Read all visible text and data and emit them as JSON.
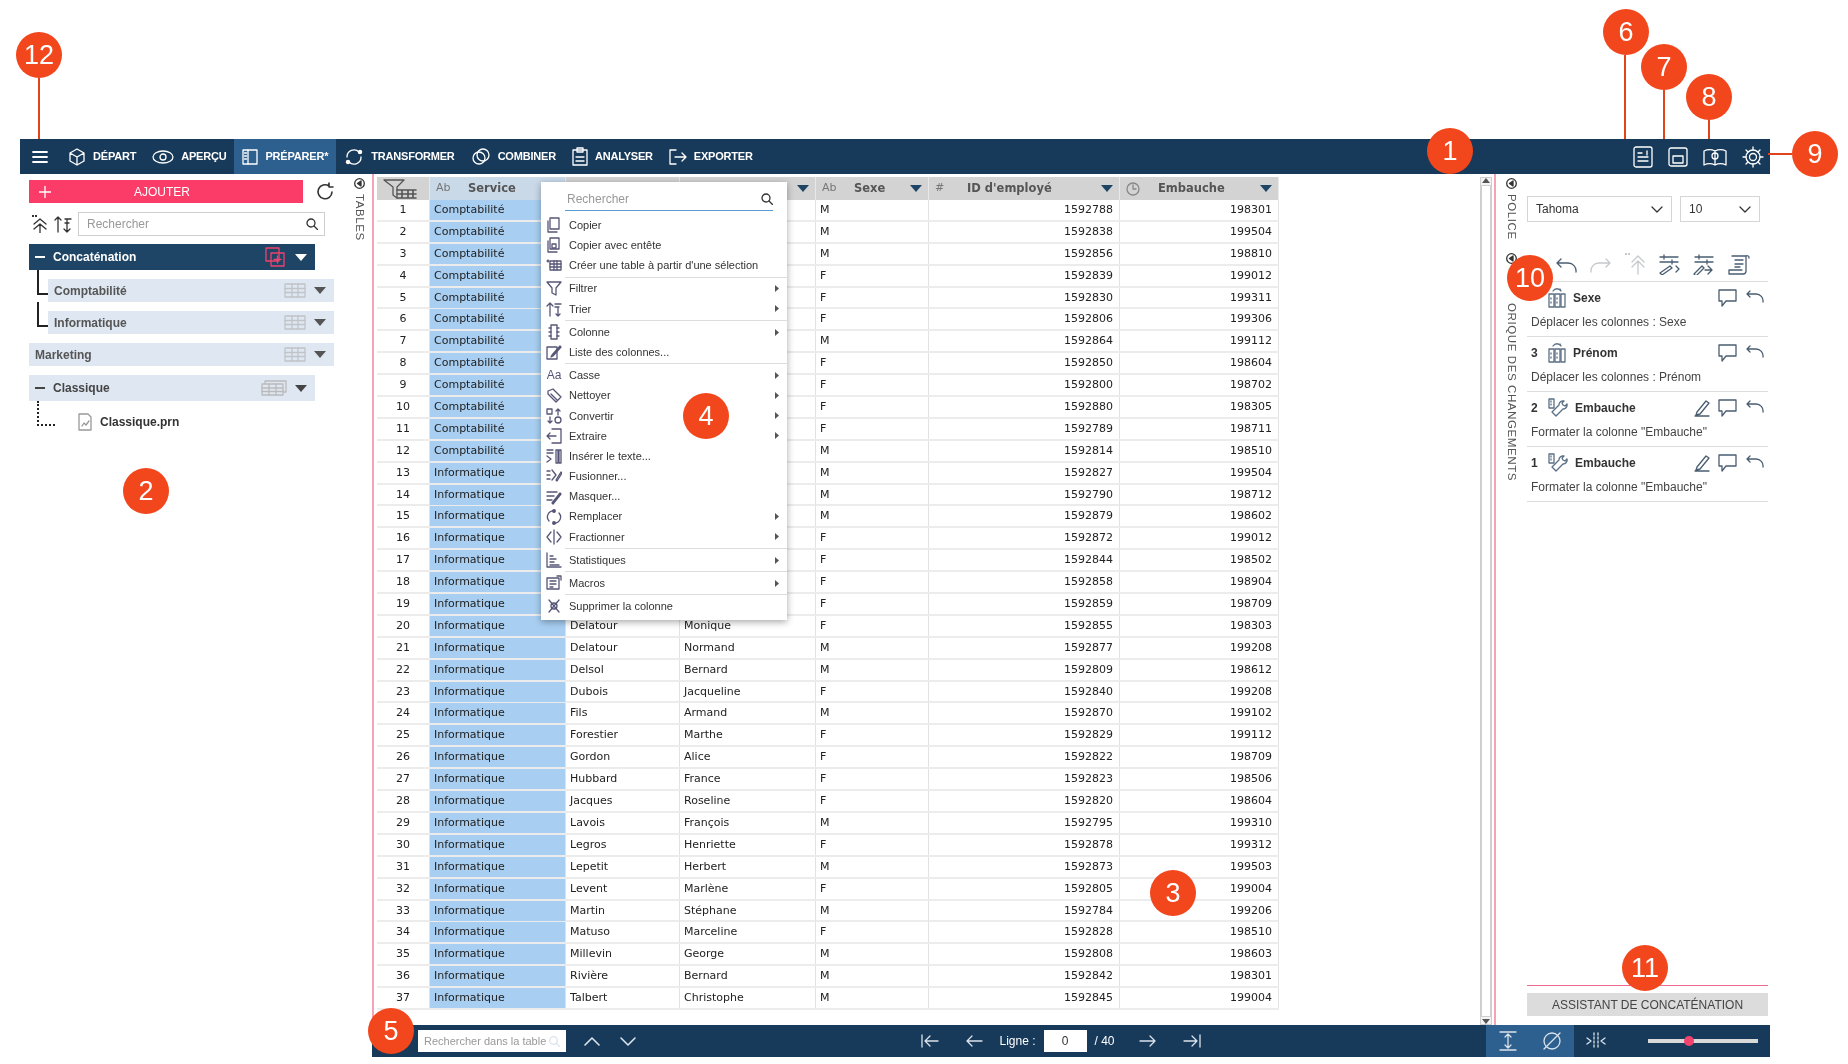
{
  "callouts": [
    {
      "number": "12"
    },
    {
      "number": "6"
    },
    {
      "number": "7"
    },
    {
      "number": "8"
    },
    {
      "number": "1"
    },
    {
      "number": "9"
    },
    {
      "number": "10"
    },
    {
      "number": "2"
    },
    {
      "number": "4"
    },
    {
      "number": "3"
    },
    {
      "number": "11"
    },
    {
      "number": "5"
    }
  ],
  "toolbar": {
    "nav": [
      {
        "label": "DÉPART",
        "selected": false
      },
      {
        "label": "APERÇU",
        "selected": false
      },
      {
        "label": "PRÉPARER*",
        "selected": true
      },
      {
        "label": "TRANSFORMER",
        "selected": false
      },
      {
        "label": "COMBINER",
        "selected": false
      },
      {
        "label": "ANALYSER",
        "selected": false
      },
      {
        "label": "EXPORTER",
        "selected": false
      }
    ]
  },
  "left_panel": {
    "add_button": "AJOUTER",
    "search": {
      "placeholder": "Rechercher"
    },
    "side_label": "TABLES",
    "tree": [
      {
        "label": "Concaténation",
        "kind": "group",
        "selected": true,
        "expanded": true,
        "children": [
          {
            "label": "Comptabilité",
            "kind": "table"
          },
          {
            "label": "Informatique",
            "kind": "table"
          }
        ]
      },
      {
        "label": "Marketing",
        "kind": "table"
      },
      {
        "label": "Classique",
        "kind": "group",
        "selected": false,
        "expanded": true,
        "children": [
          {
            "label": "Classique.prn",
            "kind": "file"
          }
        ]
      }
    ]
  },
  "table": {
    "columns": [
      {
        "kind": "text",
        "glyph": "Ab",
        "label": "Service",
        "selected": true
      },
      {
        "kind": "covered",
        "selected": false
      },
      {
        "kind": "covered",
        "selected": false,
        "caret": true
      },
      {
        "kind": "text",
        "glyph": "Ab",
        "label": "Sexe",
        "selected": false,
        "caret": true
      },
      {
        "kind": "number",
        "glyph": "#",
        "label": "ID d'employé",
        "selected": false,
        "caret": true
      },
      {
        "kind": "date",
        "label": "Embauche",
        "selected": false,
        "caret": true
      }
    ],
    "rows": [
      {
        "n": "1",
        "service": "Comptabilité",
        "sexe": "M",
        "id": "1592788",
        "embauche": "198301"
      },
      {
        "n": "2",
        "service": "Comptabilité",
        "sexe": "M",
        "id": "1592838",
        "embauche": "199504"
      },
      {
        "n": "3",
        "service": "Comptabilité",
        "sexe": "M",
        "id": "1592856",
        "embauche": "198810"
      },
      {
        "n": "4",
        "service": "Comptabilité",
        "sexe": "F",
        "id": "1592839",
        "embauche": "199012"
      },
      {
        "n": "5",
        "service": "Comptabilité",
        "sexe": "F",
        "id": "1592830",
        "embauche": "199311"
      },
      {
        "n": "6",
        "service": "Comptabilité",
        "sexe": "F",
        "id": "1592806",
        "embauche": "199306"
      },
      {
        "n": "7",
        "service": "Comptabilité",
        "sexe": "M",
        "id": "1592864",
        "embauche": "199112"
      },
      {
        "n": "8",
        "service": "Comptabilité",
        "sexe": "F",
        "id": "1592850",
        "embauche": "198604"
      },
      {
        "n": "9",
        "service": "Comptabilité",
        "sexe": "F",
        "id": "1592800",
        "embauche": "198702"
      },
      {
        "n": "10",
        "service": "Comptabilité",
        "sexe": "F",
        "id": "1592880",
        "embauche": "198305"
      },
      {
        "n": "11",
        "service": "Comptabilité",
        "sexe": "F",
        "id": "1592789",
        "embauche": "198711"
      },
      {
        "n": "12",
        "service": "Comptabilité",
        "sexe": "M",
        "id": "1592814",
        "embauche": "198510"
      },
      {
        "n": "13",
        "service": "Informatique",
        "sexe": "M",
        "id": "1592827",
        "embauche": "199504"
      },
      {
        "n": "14",
        "service": "Informatique",
        "sexe": "M",
        "id": "1592790",
        "embauche": "198712"
      },
      {
        "n": "15",
        "service": "Informatique",
        "sexe": "M",
        "id": "1592879",
        "embauche": "198602"
      },
      {
        "n": "16",
        "service": "Informatique",
        "sexe": "F",
        "id": "1592872",
        "embauche": "199012"
      },
      {
        "n": "17",
        "service": "Informatique",
        "sexe": "F",
        "id": "1592844",
        "embauche": "198502"
      },
      {
        "n": "18",
        "service": "Informatique",
        "sexe": "F",
        "id": "1592858",
        "embauche": "198904"
      },
      {
        "n": "19",
        "service": "Informatique",
        "sexe": "F",
        "id": "1592859",
        "embauche": "198709"
      },
      {
        "n": "20",
        "service": "Informatique",
        "nom": "Delatour",
        "prenom": "Monique",
        "sexe": "F",
        "id": "1592855",
        "embauche": "198303"
      },
      {
        "n": "21",
        "service": "Informatique",
        "nom": "Delatour",
        "prenom": "Normand",
        "sexe": "M",
        "id": "1592877",
        "embauche": "199208"
      },
      {
        "n": "22",
        "service": "Informatique",
        "nom": "Delsol",
        "prenom": "Bernard",
        "sexe": "M",
        "id": "1592809",
        "embauche": "198612"
      },
      {
        "n": "23",
        "service": "Informatique",
        "nom": "Dubois",
        "prenom": "Jacqueline",
        "sexe": "F",
        "id": "1592840",
        "embauche": "199208"
      },
      {
        "n": "24",
        "service": "Informatique",
        "nom": "Fils",
        "prenom": "Armand",
        "sexe": "M",
        "id": "1592870",
        "embauche": "199102"
      },
      {
        "n": "25",
        "service": "Informatique",
        "nom": "Forestier",
        "prenom": "Marthe",
        "sexe": "F",
        "id": "1592829",
        "embauche": "199112"
      },
      {
        "n": "26",
        "service": "Informatique",
        "nom": "Gordon",
        "prenom": "Alice",
        "sexe": "F",
        "id": "1592822",
        "embauche": "198709"
      },
      {
        "n": "27",
        "service": "Informatique",
        "nom": "Hubbard",
        "prenom": "France",
        "sexe": "F",
        "id": "1592823",
        "embauche": "198506"
      },
      {
        "n": "28",
        "service": "Informatique",
        "nom": "Jacques",
        "prenom": "Roseline",
        "sexe": "F",
        "id": "1592820",
        "embauche": "198604"
      },
      {
        "n": "29",
        "service": "Informatique",
        "nom": "Lavois",
        "prenom": "François",
        "sexe": "M",
        "id": "1592795",
        "embauche": "199310"
      },
      {
        "n": "30",
        "service": "Informatique",
        "nom": "Legros",
        "prenom": "Henriette",
        "sexe": "F",
        "id": "1592878",
        "embauche": "199312"
      },
      {
        "n": "31",
        "service": "Informatique",
        "nom": "Lepetit",
        "prenom": "Herbert",
        "sexe": "M",
        "id": "1592873",
        "embauche": "199503"
      },
      {
        "n": "32",
        "service": "Informatique",
        "nom": "Levent",
        "prenom": "Marlène",
        "sexe": "F",
        "id": "1592805",
        "embauche": "199004"
      },
      {
        "n": "33",
        "service": "Informatique",
        "nom": "Martin",
        "prenom": "Stéphane",
        "sexe": "M",
        "id": "1592784",
        "embauche": "199206"
      },
      {
        "n": "34",
        "service": "Informatique",
        "nom": "Matuso",
        "prenom": "Marceline",
        "sexe": "F",
        "id": "1592828",
        "embauche": "198510"
      },
      {
        "n": "35",
        "service": "Informatique",
        "nom": "Millevin",
        "prenom": "George",
        "sexe": "M",
        "id": "1592808",
        "embauche": "198603"
      },
      {
        "n": "36",
        "service": "Informatique",
        "nom": "Rivière",
        "prenom": "Bernard",
        "sexe": "M",
        "id": "1592842",
        "embauche": "198301"
      },
      {
        "n": "37",
        "service": "Informatique",
        "nom": "Talbert",
        "prenom": "Christophe",
        "sexe": "M",
        "id": "1592845",
        "embauche": "199004"
      }
    ]
  },
  "context_menu": {
    "search": {
      "placeholder": "Rechercher"
    },
    "items": [
      {
        "label": "Copier",
        "submenu": false,
        "divider_before": false
      },
      {
        "label": "Copier avec entête",
        "submenu": false,
        "divider_before": false
      },
      {
        "label": "Créer une table à partir d'une sélection",
        "submenu": false,
        "divider_before": false
      },
      {
        "label": "Filtrer",
        "submenu": true,
        "divider_before": true
      },
      {
        "label": "Trier",
        "submenu": true,
        "divider_before": false
      },
      {
        "label": "Colonne",
        "submenu": true,
        "divider_before": true
      },
      {
        "label": "Liste des colonnes...",
        "submenu": false,
        "divider_before": false
      },
      {
        "label": "Casse",
        "glyph": "Aa",
        "submenu": true,
        "divider_before": true
      },
      {
        "label": "Nettoyer",
        "submenu": true,
        "divider_before": false
      },
      {
        "label": "Convertir",
        "submenu": true,
        "divider_before": false
      },
      {
        "label": "Extraire",
        "submenu": true,
        "divider_before": false
      },
      {
        "label": "Insérer le texte...",
        "submenu": false,
        "divider_before": false
      },
      {
        "label": "Fusionner...",
        "submenu": false,
        "divider_before": false
      },
      {
        "label": "Masquer...",
        "submenu": false,
        "divider_before": false
      },
      {
        "label": "Remplacer",
        "submenu": true,
        "divider_before": false
      },
      {
        "label": "Fractionner",
        "submenu": true,
        "divider_before": false
      },
      {
        "label": "Statistiques",
        "submenu": true,
        "divider_before": true
      },
      {
        "label": "Macros",
        "submenu": true,
        "divider_before": true
      },
      {
        "label": "Supprimer la colonne",
        "submenu": false,
        "divider_before": true
      }
    ]
  },
  "right_panel": {
    "side_labels": [
      "POLICE",
      "ORIQUE DES CHANGEMENTS"
    ],
    "font": {
      "family": "Tahoma",
      "size": "10"
    },
    "history_tools": [
      {
        "disabled": false
      },
      {
        "disabled": true
      },
      {
        "disabled": true
      },
      {
        "disabled": false
      },
      {
        "disabled": false
      },
      {
        "disabled": false
      }
    ],
    "history": [
      {
        "title": "Sexe",
        "description": "Déplacer les colonnes : Sexe",
        "kind": "move",
        "editable": false
      },
      {
        "number": "3",
        "title": "Prénom",
        "description": "Déplacer les colonnes : Prénom",
        "kind": "move",
        "editable": false
      },
      {
        "number": "2",
        "title": "Embauche",
        "description": "Formater la colonne \"Embauche\"",
        "kind": "format",
        "editable": true
      },
      {
        "number": "1",
        "title": "Embauche",
        "description": "Formater la colonne \"Embauche\"",
        "kind": "format",
        "editable": true
      }
    ],
    "assistant_button": "ASSISTANT DE CONCATÉNATION"
  },
  "bottom_bar": {
    "search": {
      "placeholder": "Rechercher dans la table"
    },
    "line_label": "Ligne :",
    "line_value": "0",
    "line_total": "/ 40",
    "toggles": [
      {
        "on": true
      },
      {
        "on": true
      },
      {
        "on": false
      }
    ],
    "zoom": {
      "level": 0.37
    }
  }
}
